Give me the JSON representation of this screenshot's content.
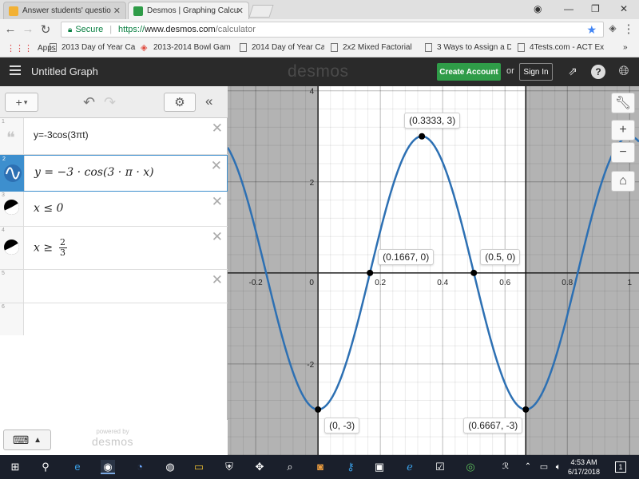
{
  "browser": {
    "tabs": [
      {
        "title": "Answer students' questio",
        "active": false
      },
      {
        "title": "Desmos | Graphing Calcu",
        "active": true
      }
    ],
    "url": {
      "secure_label": "Secure",
      "scheme": "https://",
      "host": "www.desmos.com",
      "path": "/calculator"
    },
    "bookmarks": [
      {
        "label": "Apps"
      },
      {
        "label": "2013 Day of Year Ca"
      },
      {
        "label": "2013-2014 Bowl Gam"
      },
      {
        "label": "2014 Day of Year Cal"
      },
      {
        "label": "2x2 Mixed Factorial"
      },
      {
        "label": "3 Ways to Assign a D"
      },
      {
        "label": "4Tests.com - ACT Ex"
      }
    ],
    "more_label": "»"
  },
  "desmos": {
    "graph_title": "Untitled Graph",
    "logo": "desmos",
    "create_account": "Create Account",
    "or": "or",
    "sign_in": "Sign In",
    "help": "?",
    "expressions": [
      {
        "num": "1",
        "kind": "note",
        "text": "y=-3cos(3πt)"
      },
      {
        "num": "2",
        "kind": "function",
        "text": "y = −3 · cos(3 · π · x)"
      },
      {
        "num": "3",
        "kind": "inequality",
        "text": "x ≤ 0"
      },
      {
        "num": "4",
        "kind": "inequality",
        "lhs": "x ≥",
        "num_top": "2",
        "num_bottom": "3"
      },
      {
        "num": "5",
        "kind": "empty"
      },
      {
        "num": "6",
        "kind": "empty"
      }
    ],
    "powered_by": "powered by",
    "powered_logo": "desmos"
  },
  "graph": {
    "x_ticks": [
      "-0.2",
      "0",
      "0.2",
      "0.4",
      "0.6",
      "0.8",
      "1"
    ],
    "y_ticks": [
      "4",
      "2",
      "-2"
    ],
    "xrange": [
      -0.29,
      1.03
    ],
    "yrange": [
      -4.0,
      4.1
    ],
    "curve_color": "#2d70b3",
    "shade_color": "#9a9a9a",
    "points": [
      {
        "label": "(0.3333, 3)",
        "x": 0.3333,
        "y": 3
      },
      {
        "label": "(0.1667, 0)",
        "x": 0.1667,
        "y": 0
      },
      {
        "label": "(0.5, 0)",
        "x": 0.5,
        "y": 0
      },
      {
        "label": "(0, -3)",
        "x": 0,
        "y": -3
      },
      {
        "label": "(0.6667, -3)",
        "x": 0.6667,
        "y": -3
      }
    ]
  },
  "taskbar": {
    "time": "4:53 AM",
    "date": "6/17/2018",
    "notification_count": "1"
  }
}
